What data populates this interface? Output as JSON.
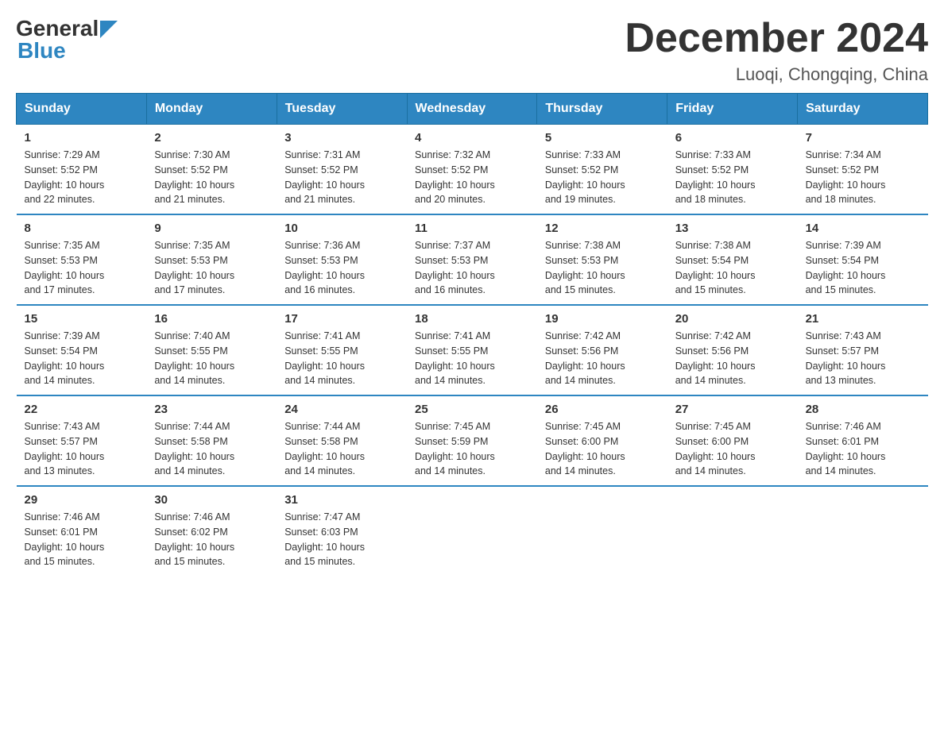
{
  "logo": {
    "general": "General",
    "blue": "Blue"
  },
  "title": "December 2024",
  "subtitle": "Luoqi, Chongqing, China",
  "headers": [
    "Sunday",
    "Monday",
    "Tuesday",
    "Wednesday",
    "Thursday",
    "Friday",
    "Saturday"
  ],
  "weeks": [
    [
      {
        "day": "1",
        "info": "Sunrise: 7:29 AM\nSunset: 5:52 PM\nDaylight: 10 hours\nand 22 minutes."
      },
      {
        "day": "2",
        "info": "Sunrise: 7:30 AM\nSunset: 5:52 PM\nDaylight: 10 hours\nand 21 minutes."
      },
      {
        "day": "3",
        "info": "Sunrise: 7:31 AM\nSunset: 5:52 PM\nDaylight: 10 hours\nand 21 minutes."
      },
      {
        "day": "4",
        "info": "Sunrise: 7:32 AM\nSunset: 5:52 PM\nDaylight: 10 hours\nand 20 minutes."
      },
      {
        "day": "5",
        "info": "Sunrise: 7:33 AM\nSunset: 5:52 PM\nDaylight: 10 hours\nand 19 minutes."
      },
      {
        "day": "6",
        "info": "Sunrise: 7:33 AM\nSunset: 5:52 PM\nDaylight: 10 hours\nand 18 minutes."
      },
      {
        "day": "7",
        "info": "Sunrise: 7:34 AM\nSunset: 5:52 PM\nDaylight: 10 hours\nand 18 minutes."
      }
    ],
    [
      {
        "day": "8",
        "info": "Sunrise: 7:35 AM\nSunset: 5:53 PM\nDaylight: 10 hours\nand 17 minutes."
      },
      {
        "day": "9",
        "info": "Sunrise: 7:35 AM\nSunset: 5:53 PM\nDaylight: 10 hours\nand 17 minutes."
      },
      {
        "day": "10",
        "info": "Sunrise: 7:36 AM\nSunset: 5:53 PM\nDaylight: 10 hours\nand 16 minutes."
      },
      {
        "day": "11",
        "info": "Sunrise: 7:37 AM\nSunset: 5:53 PM\nDaylight: 10 hours\nand 16 minutes."
      },
      {
        "day": "12",
        "info": "Sunrise: 7:38 AM\nSunset: 5:53 PM\nDaylight: 10 hours\nand 15 minutes."
      },
      {
        "day": "13",
        "info": "Sunrise: 7:38 AM\nSunset: 5:54 PM\nDaylight: 10 hours\nand 15 minutes."
      },
      {
        "day": "14",
        "info": "Sunrise: 7:39 AM\nSunset: 5:54 PM\nDaylight: 10 hours\nand 15 minutes."
      }
    ],
    [
      {
        "day": "15",
        "info": "Sunrise: 7:39 AM\nSunset: 5:54 PM\nDaylight: 10 hours\nand 14 minutes."
      },
      {
        "day": "16",
        "info": "Sunrise: 7:40 AM\nSunset: 5:55 PM\nDaylight: 10 hours\nand 14 minutes."
      },
      {
        "day": "17",
        "info": "Sunrise: 7:41 AM\nSunset: 5:55 PM\nDaylight: 10 hours\nand 14 minutes."
      },
      {
        "day": "18",
        "info": "Sunrise: 7:41 AM\nSunset: 5:55 PM\nDaylight: 10 hours\nand 14 minutes."
      },
      {
        "day": "19",
        "info": "Sunrise: 7:42 AM\nSunset: 5:56 PM\nDaylight: 10 hours\nand 14 minutes."
      },
      {
        "day": "20",
        "info": "Sunrise: 7:42 AM\nSunset: 5:56 PM\nDaylight: 10 hours\nand 14 minutes."
      },
      {
        "day": "21",
        "info": "Sunrise: 7:43 AM\nSunset: 5:57 PM\nDaylight: 10 hours\nand 13 minutes."
      }
    ],
    [
      {
        "day": "22",
        "info": "Sunrise: 7:43 AM\nSunset: 5:57 PM\nDaylight: 10 hours\nand 13 minutes."
      },
      {
        "day": "23",
        "info": "Sunrise: 7:44 AM\nSunset: 5:58 PM\nDaylight: 10 hours\nand 14 minutes."
      },
      {
        "day": "24",
        "info": "Sunrise: 7:44 AM\nSunset: 5:58 PM\nDaylight: 10 hours\nand 14 minutes."
      },
      {
        "day": "25",
        "info": "Sunrise: 7:45 AM\nSunset: 5:59 PM\nDaylight: 10 hours\nand 14 minutes."
      },
      {
        "day": "26",
        "info": "Sunrise: 7:45 AM\nSunset: 6:00 PM\nDaylight: 10 hours\nand 14 minutes."
      },
      {
        "day": "27",
        "info": "Sunrise: 7:45 AM\nSunset: 6:00 PM\nDaylight: 10 hours\nand 14 minutes."
      },
      {
        "day": "28",
        "info": "Sunrise: 7:46 AM\nSunset: 6:01 PM\nDaylight: 10 hours\nand 14 minutes."
      }
    ],
    [
      {
        "day": "29",
        "info": "Sunrise: 7:46 AM\nSunset: 6:01 PM\nDaylight: 10 hours\nand 15 minutes."
      },
      {
        "day": "30",
        "info": "Sunrise: 7:46 AM\nSunset: 6:02 PM\nDaylight: 10 hours\nand 15 minutes."
      },
      {
        "day": "31",
        "info": "Sunrise: 7:47 AM\nSunset: 6:03 PM\nDaylight: 10 hours\nand 15 minutes."
      },
      {
        "day": "",
        "info": ""
      },
      {
        "day": "",
        "info": ""
      },
      {
        "day": "",
        "info": ""
      },
      {
        "day": "",
        "info": ""
      }
    ]
  ]
}
